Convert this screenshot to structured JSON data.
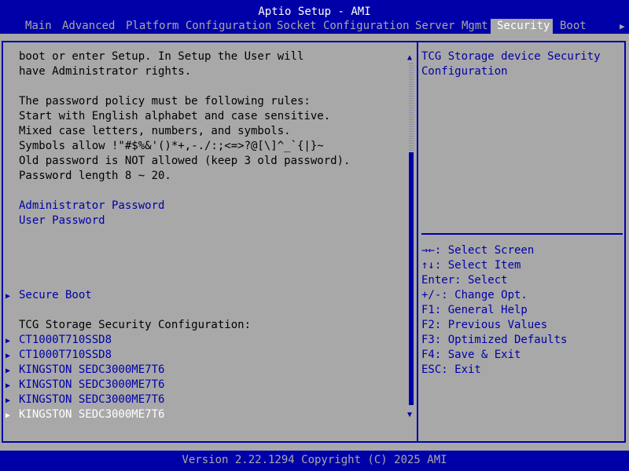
{
  "header": {
    "title": "Aptio Setup - AMI",
    "tabs": [
      {
        "label": "Main"
      },
      {
        "label": "Advanced"
      },
      {
        "label": "Platform Configuration"
      },
      {
        "label": "Socket Configuration"
      },
      {
        "label": "Server Mgmt"
      },
      {
        "label": "Security"
      },
      {
        "label": "Boot"
      }
    ],
    "more_arrow": "▶"
  },
  "main": {
    "text_lines": [
      "boot or enter Setup. In Setup the User will",
      "have Administrator rights.",
      "The password policy must be following rules:",
      "Start with English alphabet and case sensitive.",
      "Mixed case letters, numbers, and symbols.",
      "Symbols allow !\"#$%&'()*+,-./:;<=>?@[\\]^_`{|}~",
      "Old password is NOT allowed (keep 3 old password).",
      "Password length 8 ~ 20."
    ],
    "admin_password": "Administrator Password",
    "user_password": "User Password",
    "secure_boot": "Secure Boot",
    "tcg_heading": "TCG Storage Security Configuration:",
    "devices": [
      "CT1000T710SSD8",
      "CT1000T710SSD8",
      "KINGSTON SEDC3000ME7T6",
      "KINGSTON SEDC3000ME7T6",
      "KINGSTON SEDC3000ME7T6",
      "KINGSTON SEDC3000ME7T6"
    ]
  },
  "help": {
    "description": [
      "TCG Storage device Security",
      "Configuration"
    ],
    "keys": [
      "→←: Select Screen",
      "↑↓: Select Item",
      "Enter: Select",
      "+/-: Change Opt.",
      "F1: General Help",
      "F2: Previous Values",
      "F3: Optimized Defaults",
      "F4: Save & Exit",
      "ESC: Exit"
    ]
  },
  "footer": {
    "version": "Version 2.22.1294 Copyright (C) 2025 AMI"
  },
  "colors": {
    "bar": "#0000a8",
    "background": "#a8a8a8",
    "selected_text": "#ffffff"
  }
}
